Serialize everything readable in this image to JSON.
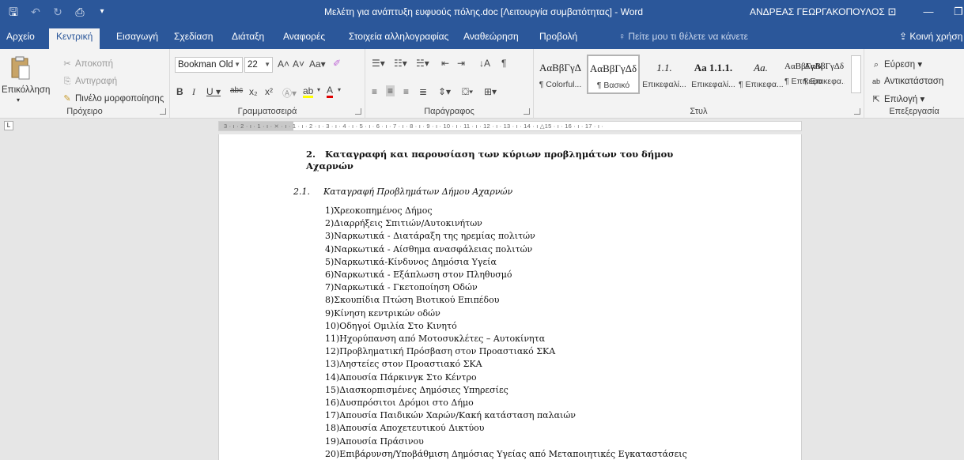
{
  "titlebar": {
    "document_title": "Μελέτη για ανάπτυξη ευφυούς πόλης.doc [Λειτουργία συμβατότητας] - Word",
    "user_name": "ΑΝΔΡΕΑΣ ΓΕΩΡΓΑΚΟΠΟΥΛΟΣ",
    "icons": [
      "save-icon",
      "undo-icon",
      "redo-icon",
      "print-preview-icon",
      "customize-icon",
      "ribbon-options-icon",
      "minimize-icon",
      "restore-icon"
    ]
  },
  "tabs": {
    "items": [
      "Αρχείο",
      "Κεντρική",
      "Εισαγωγή",
      "Σχεδίαση",
      "Διάταξη",
      "Αναφορές",
      "Στοιχεία αλληλογραφίας",
      "Αναθεώρηση",
      "Προβολή"
    ],
    "active": "Κεντρική",
    "tell_me": "Πείτε μου τι θέλετε να κάνετε",
    "share": "Κοινή χρήση"
  },
  "clipboard": {
    "paste": "Επικόλληση",
    "cut": "Αποκοπή",
    "copy": "Αντιγραφή",
    "format_painter": "Πινέλο μορφοποίησης",
    "label": "Πρόχειρο"
  },
  "font": {
    "name": "Bookman Old",
    "size": "22",
    "label": "Γραμματοσειρά"
  },
  "paragraph": {
    "label": "Παράγραφος"
  },
  "styles": {
    "label": "Στυλ",
    "items": [
      {
        "preview": "ΑαΒβΓγΔ",
        "name": "¶ Colorful..."
      },
      {
        "preview": "ΑαΒβΓγΔδ",
        "name": "¶ Βασικό"
      },
      {
        "preview": "1.1.",
        "name": "Επικεφαλί..."
      },
      {
        "preview": "Aa  1.1.1.",
        "name": "Επικεφαλί..."
      },
      {
        "preview": "Aa.",
        "name": "¶ Επικεφα..."
      },
      {
        "preview": "ΑαΒβΓγΔδ",
        "name": "¶ Επικεφα..."
      },
      {
        "preview": "ΑαΒβΓγΔδ",
        "name": "¶ Επικεφα..."
      }
    ]
  },
  "editing": {
    "find": "Εύρεση",
    "replace": "Αντικατάσταση",
    "select": "Επιλογή",
    "label": "Επεξεργασία"
  },
  "ruler": {
    "text": "3 · ı · 2 · ı · 1 · ı · ⨯ · ı · 1 · ı · 2 · ı · 3 · ı · 4 · ı · 5 · ı · 6 · ı · 7 · ı · 8 · ı · 9 · ı · 10 · ı · 11 · ı · 12 · ı · 13 · ı · 14 · ı △15 · ı · 16 · ı · 17 · ı ·"
  },
  "document": {
    "heading1_number": "2.",
    "heading1_text": "Καταγραφή και παρουσίαση των κύριων προβλημάτων του δήμου Αχαρνών",
    "heading2_number": "2.1.",
    "heading2_text": "Καταγραφή Προβλημάτων Δήμου Αχαρνών",
    "list": [
      "1)Χρεοκοπημένος Δήμος",
      "2)Διαρρήξεις Σπιτιών/Αυτοκινήτων",
      "3)Ναρκωτικά - Διατάραξη της ηρεμίας πολιτών",
      "4)Ναρκωτικά - Αίσθημα ανασφάλειας πολιτών",
      "5)Ναρκωτικά-Κίνδυνος Δημόσια Υγεία",
      "6)Ναρκωτικά - Εξάπλωση στον Πληθυσμό",
      "7)Ναρκωτικά - Γκετοποίηση Οδών",
      "8)Σκουπίδια Πτώση Βιοτικού Επιπέδου",
      "9)Κίνηση κεντρικών οδών",
      "10)Οδηγοί Ομιλία Στο Κινητό",
      "11)Ηχορύπανση από Μοτοσυκλέτες – Αυτοκίνητα",
      "12)Προβληματική Πρόσβαση στον Προαστιακό ΣΚΑ",
      "13)Ληστείες στον Προαστιακό ΣΚΑ",
      "14)Απουσία Πάρκινγκ Στο Κέντρο",
      "15)Διασκορπισμένες Δημόσιες Υπηρεσίες",
      "16)Δυσπρόσιτοι Δρόμοι στο Δήμο",
      "17)Απουσία Παιδικών Χαρών/Κακή κατάσταση παλαιών",
      "18)Απουσία Αποχετευτικού Δικτύου",
      "19)Απουσία Πράσινου",
      "20)Επιβάρυνση/Υποβάθμιση Δημόσιας Υγείας από Μεταποιητικές Εγκαταστάσεις"
    ]
  },
  "colors": {
    "word_blue": "#2b579a",
    "ribbon_bg": "#f3f3f3",
    "canvas_bg": "#e6e6e6"
  }
}
